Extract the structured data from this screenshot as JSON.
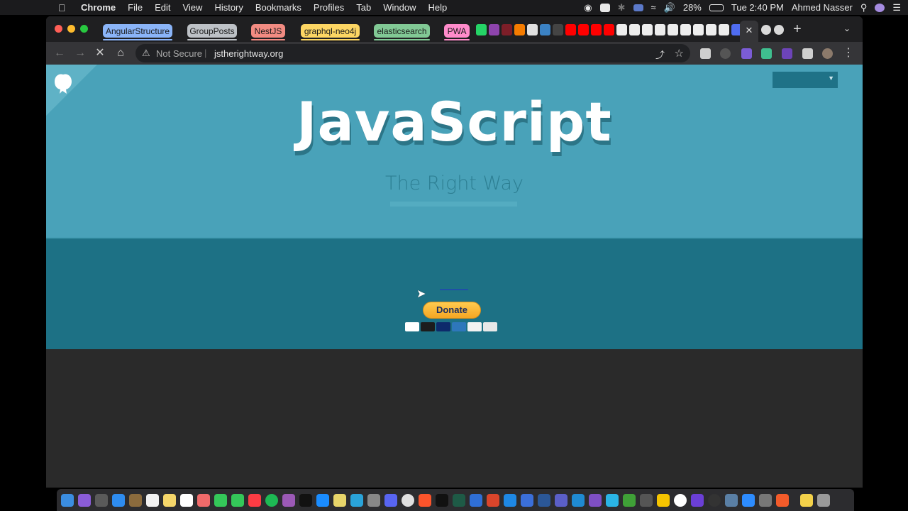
{
  "menubar": {
    "app_name": "Chrome",
    "menus": [
      "File",
      "Edit",
      "View",
      "History",
      "Bookmarks",
      "Profiles",
      "Tab",
      "Window",
      "Help"
    ],
    "battery": "28%",
    "clock": "Tue 2:40 PM",
    "user": "Ahmed Nasser"
  },
  "tab_groups": [
    {
      "label": "AngularStructure",
      "color": "#8ab4f8"
    },
    {
      "label": "GroupPosts",
      "color": "#bdc1c6"
    },
    {
      "label": "NestJS",
      "color": "#f28b82"
    },
    {
      "label": "graphql-neo4j",
      "color": "#fdd663"
    },
    {
      "label": "elasticsearch",
      "color": "#81c995"
    },
    {
      "label": "PWA",
      "color": "#ff8bcb"
    }
  ],
  "toolbar": {
    "security_label": "Not Secure",
    "url": "jstherightway.org"
  },
  "page": {
    "title": "JavaScript",
    "subtitle": "The Right Way",
    "donate_label": "Donate",
    "colors": {
      "hero": "#49a2b9",
      "band": "#1d7185",
      "footer": "#2a2a2a"
    }
  },
  "icons": {
    "back": "arrow-left-icon",
    "forward": "arrow-right-icon",
    "stop": "close-icon",
    "home": "home-icon",
    "warning": "warning-icon",
    "share": "share-icon",
    "bookmark": "star-icon"
  }
}
